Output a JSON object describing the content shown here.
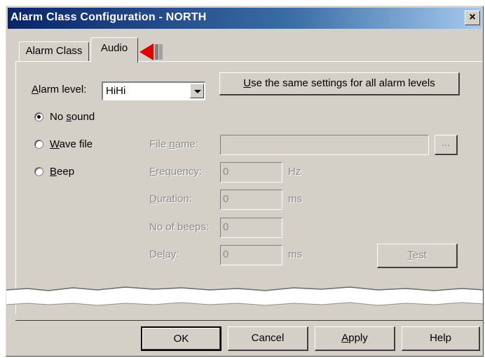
{
  "window": {
    "title": "Alarm Class Configuration - NORTH",
    "close_glyph": "×"
  },
  "tabs": [
    {
      "label": "Alarm Class",
      "active": false
    },
    {
      "label": "Audio",
      "active": true
    }
  ],
  "alarm_level": {
    "label_underlined": "A",
    "label_rest": "larm level:",
    "value": "HiHi"
  },
  "same_settings_button": {
    "underlined": "U",
    "rest": "se the same settings for all alarm levels"
  },
  "sound_options": [
    {
      "pre": "No ",
      "underlined": "s",
      "post": "ound",
      "checked": true
    },
    {
      "pre": "",
      "underlined": "W",
      "post": "ave file",
      "checked": false
    },
    {
      "pre": "",
      "underlined": "B",
      "post": "eep",
      "checked": false
    }
  ],
  "file_name": {
    "pre": "File ",
    "underlined": "n",
    "post": "ame:",
    "value": ""
  },
  "browse_button": {
    "label": "..."
  },
  "frequency": {
    "underlined": "F",
    "post": "requency:",
    "value": "0",
    "unit": "Hz"
  },
  "duration": {
    "underlined": "D",
    "post": "uration:",
    "value": "0",
    "unit": "ms"
  },
  "no_of_beeps": {
    "label": "No of beeps:",
    "value": "0"
  },
  "delay": {
    "pre": "De",
    "underlined": "l",
    "post": "ay:",
    "value": "0",
    "unit": "ms"
  },
  "test_button": {
    "underlined": "T",
    "rest": "est"
  },
  "footer": {
    "ok": "OK",
    "cancel": "Cancel",
    "apply": {
      "underlined": "A",
      "rest": "pply"
    },
    "help": "Help"
  },
  "colors": {
    "dialog_bg": "#d4d0c8",
    "title_bar": "#0a246a",
    "pointer_arrow": "#e00000",
    "disabled_text": "#8c8c8c"
  }
}
